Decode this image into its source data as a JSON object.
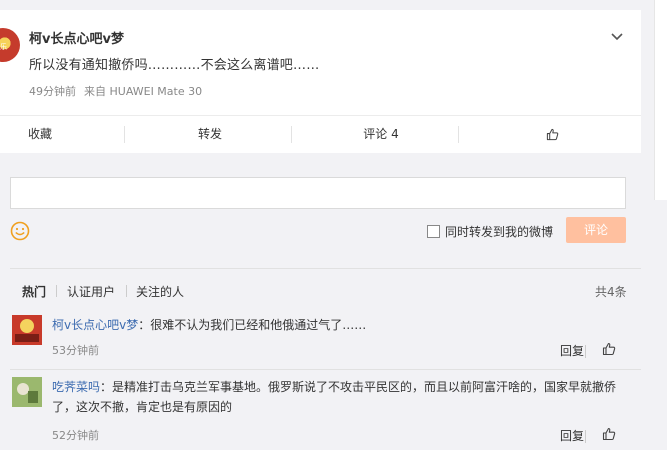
{
  "post": {
    "author": "柯v长点心吧v梦",
    "avatar_text": "乐",
    "text": "所以没有通知撤侨吗…………不会这么离谱吧……",
    "time": "49分钟前",
    "source": "来自 HUAWEI Mate 30"
  },
  "actions": {
    "favorite": "收藏",
    "forward": "转发",
    "comment": "评论 4"
  },
  "composer": {
    "input_value": "",
    "forward_label": "同时转发到我的微博",
    "submit_label": "评论"
  },
  "comments_section": {
    "tabs": [
      "热门",
      "认证用户",
      "关注的人"
    ],
    "total": "共4条"
  },
  "comments": [
    {
      "name": "柯v长点心吧v梦",
      "text": "：很难不认为我们已经和他俄通过气了……",
      "time": "53分钟前",
      "reply": "回复",
      "avatar_text": "宇宙最乐"
    },
    {
      "name": "吃荠菜吗",
      "text": "：是精准打击乌克兰军事基地。俄罗斯说了不攻击平民区的，而且以前阿富汗啥的，国家早就撤侨了，这次不撤，肯定也是有原因的",
      "time": "52分钟前",
      "reply": "回复"
    }
  ],
  "colors": {
    "name_link": "#3c6bb0",
    "submit_disabled": "#ffc09f",
    "emoji": "#f0a020"
  },
  "icons": {
    "expand": "chevron-down-icon",
    "like": "thumbs-up-icon",
    "emoji": "smiley-icon"
  }
}
